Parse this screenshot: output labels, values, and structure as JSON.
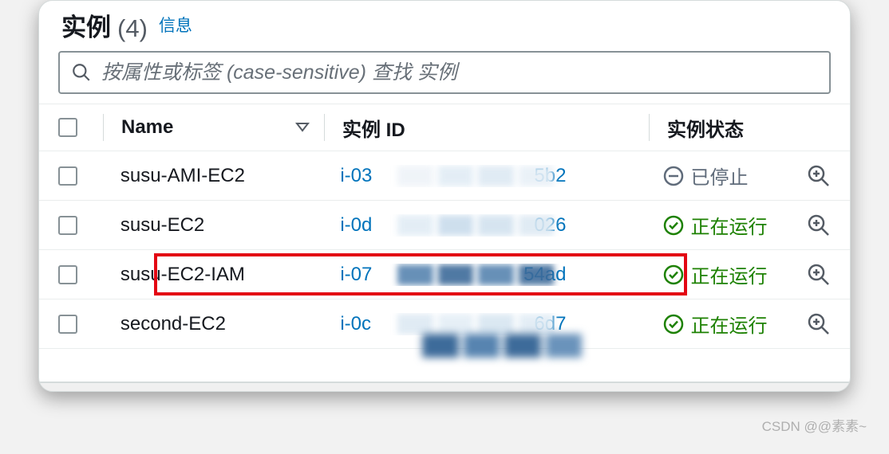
{
  "header": {
    "title": "实例",
    "count": "(4)",
    "info_label": "信息"
  },
  "search": {
    "placeholder": "按属性或标签 (case-sensitive) 查找 实例"
  },
  "columns": {
    "name": "Name",
    "id": "实例 ID",
    "state": "实例状态"
  },
  "status_labels": {
    "stopped": "已停止",
    "running": "正在运行"
  },
  "rows": [
    {
      "name": "susu-AMI-EC2",
      "id_prefix": "i-03",
      "id_suffix": "5b2",
      "state": "stopped",
      "highlighted": false
    },
    {
      "name": "susu-EC2",
      "id_prefix": "i-0d",
      "id_suffix": "026",
      "state": "running",
      "highlighted": false
    },
    {
      "name": "susu-EC2-IAM",
      "id_prefix": "i-07",
      "id_suffix": "54ad",
      "state": "running",
      "highlighted": true
    },
    {
      "name": "second-EC2",
      "id_prefix": "i-0c",
      "id_suffix": "6d7",
      "state": "running",
      "highlighted": false
    }
  ],
  "watermark": "CSDN @@素素~"
}
